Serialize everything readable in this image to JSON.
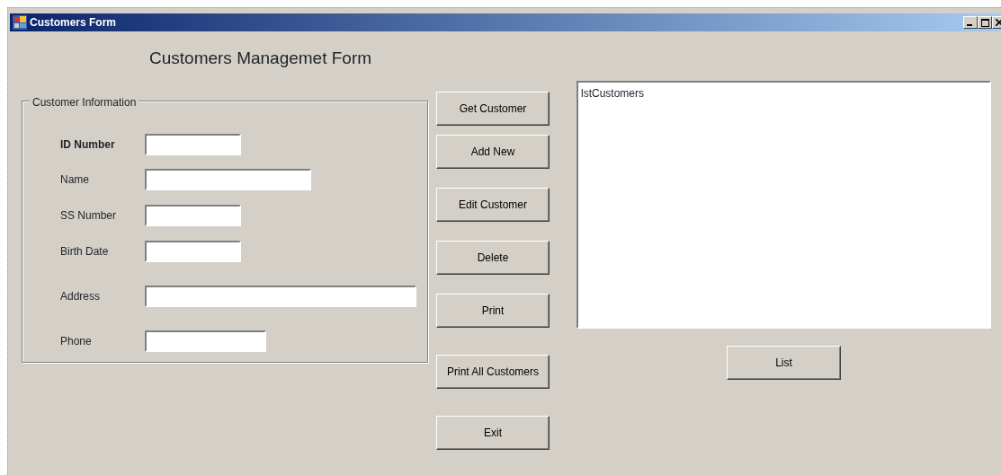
{
  "window": {
    "title": "Customers Form"
  },
  "heading": "Customers Managemet Form",
  "group": {
    "title": "Customer Information",
    "fields": [
      {
        "label": "ID Number",
        "bold": true
      },
      {
        "label": "Name",
        "bold": false
      },
      {
        "label": "SS Number",
        "bold": false
      },
      {
        "label": "Birth Date",
        "bold": false
      },
      {
        "label": "Address",
        "bold": false
      },
      {
        "label": "Phone",
        "bold": false
      }
    ]
  },
  "buttons": [
    "Get Customer",
    "Add New",
    "Edit Customer",
    "Delete",
    "Print",
    "Print All Customers",
    "Exit"
  ],
  "listbox": {
    "items": [
      "lstCustomers"
    ]
  },
  "list_button": "List"
}
